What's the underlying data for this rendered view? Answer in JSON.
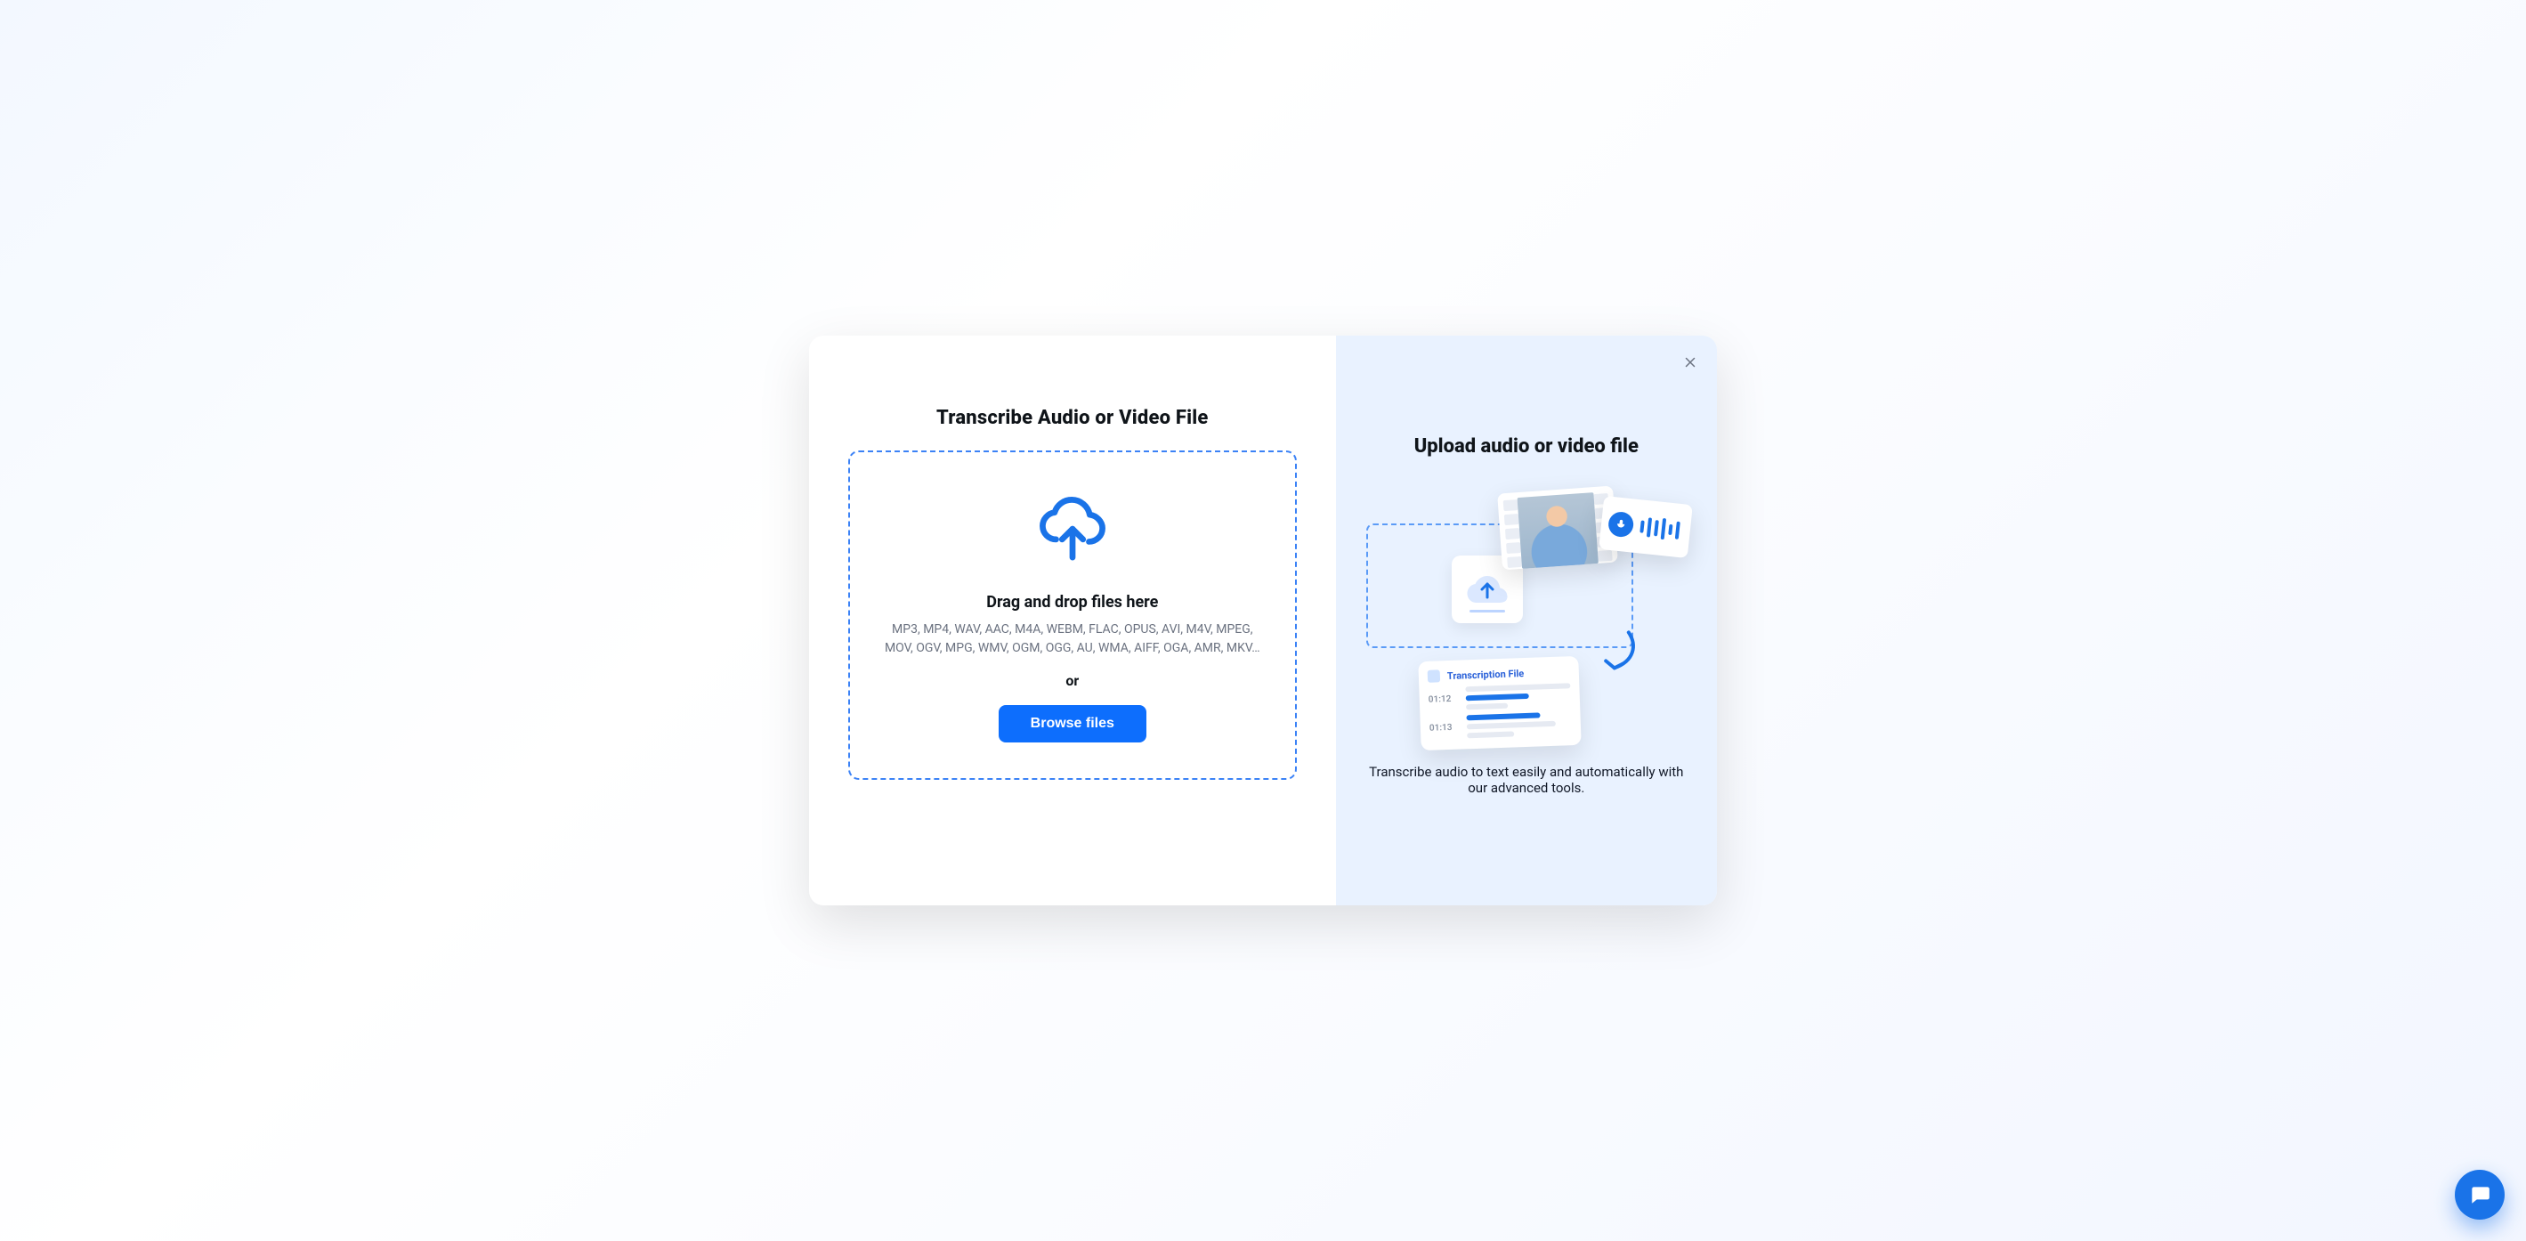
{
  "left": {
    "title": "Transcribe Audio or Video File",
    "drop_title": "Drag and drop files here",
    "formats": "MP3, MP4, WAV, AAC, M4A, WEBM, FLAC, OPUS, AVI, M4V, MPEG, MOV, OGV, MPG, WMV, OGM, OGG, AU, WMA, AIFF, OGA, AMR, MKV…",
    "or": "or",
    "browse_label": "Browse files"
  },
  "right": {
    "title": "Upload audio or video file",
    "subtitle": "Transcribe audio to text easily and automatically with our advanced tools.",
    "transcription_label": "Transcription File",
    "timestamps": [
      "01:12",
      "01:13"
    ]
  }
}
